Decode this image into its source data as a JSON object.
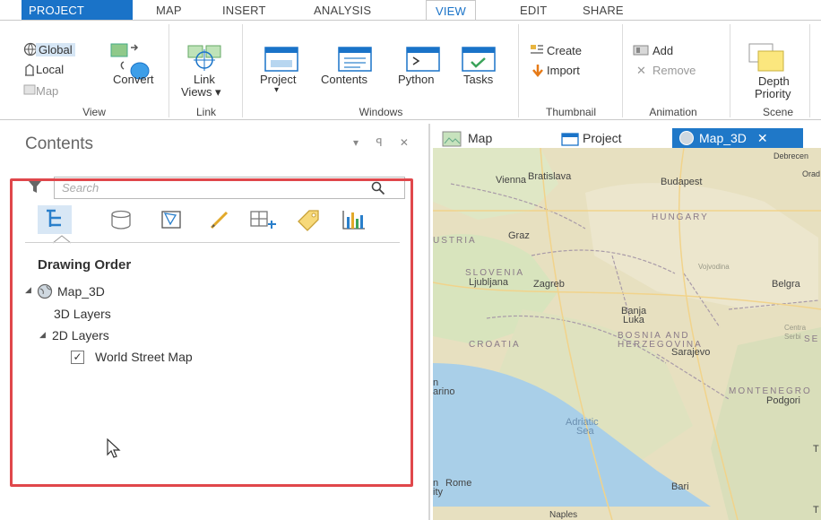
{
  "ribbon_tabs": [
    "PROJECT",
    "MAP",
    "INSERT",
    "ANALYSIS",
    "VIEW",
    "EDIT",
    "SHARE"
  ],
  "ribbon": {
    "view_group": {
      "global": "Global",
      "local": "Local",
      "map": "Map",
      "convert": "Convert",
      "label": "View"
    },
    "link_group": {
      "link_views": "Link",
      "link_views2": "Views ▾",
      "label": "Link"
    },
    "windows_group": {
      "project": "Project",
      "contents": "Contents",
      "python": "Python",
      "tasks": "Tasks",
      "label": "Windows"
    },
    "thumbnail_group": {
      "create": "Create",
      "import": "Import",
      "label": "Thumbnail"
    },
    "animation_group": {
      "add": "Add",
      "remove": "Remove",
      "label": "Animation"
    },
    "scene_group": {
      "depth": "Depth",
      "priority": "Priority",
      "label": "Scene"
    }
  },
  "contents_pane": {
    "title": "Contents",
    "controls": "▾ ꟼ ✕",
    "search_placeholder": "Search",
    "section_title": "Drawing Order",
    "tree": {
      "map_name": "Map_3D",
      "layers_3d": "3D Layers",
      "layers_2d": "2D Layers",
      "world_street_map": "World Street Map"
    }
  },
  "map_tabs": [
    "Map",
    "Project",
    "Map_3D"
  ],
  "map_labels": {
    "vienna": "Vienna",
    "bratislava": "Bratislava",
    "budapest": "Budapest",
    "hungary": "HUNGARY",
    "austria": "USTRIA",
    "graz": "Graz",
    "slovenia": "SLOVENIA",
    "ljubljana": "Ljubljana",
    "zagreb": "Zagreb",
    "croatia": "CROATIA",
    "banja1": "Banja",
    "banja2": "Luka",
    "bosnia1": "BOSNIA AND",
    "bosnia2": "HERZEGOVINA",
    "sarajevo": "Sarajevo",
    "belgrade": "Belgra",
    "montenegro": "MONTENEGRO",
    "podgorica": "Podgori",
    "adriatic1": "Adriatic",
    "adriatic2": "Sea",
    "rome": "Rome",
    "bari": "Bari",
    "naples": "Naples",
    "marino": "arino",
    "sm1": "n",
    "rome_prefix": "n",
    "ity": "ity",
    "debrecen": "Debrecen",
    "oradea": "Orad",
    "vojvodina": "Vojvodina",
    "central_serbia1": "Centra",
    "central_serbia2": "Serbi",
    "se": "SE",
    "t1": "T",
    "t2": "T"
  },
  "colors": {
    "accent": "#1a73c8",
    "highlight_box": "#e0474b"
  }
}
